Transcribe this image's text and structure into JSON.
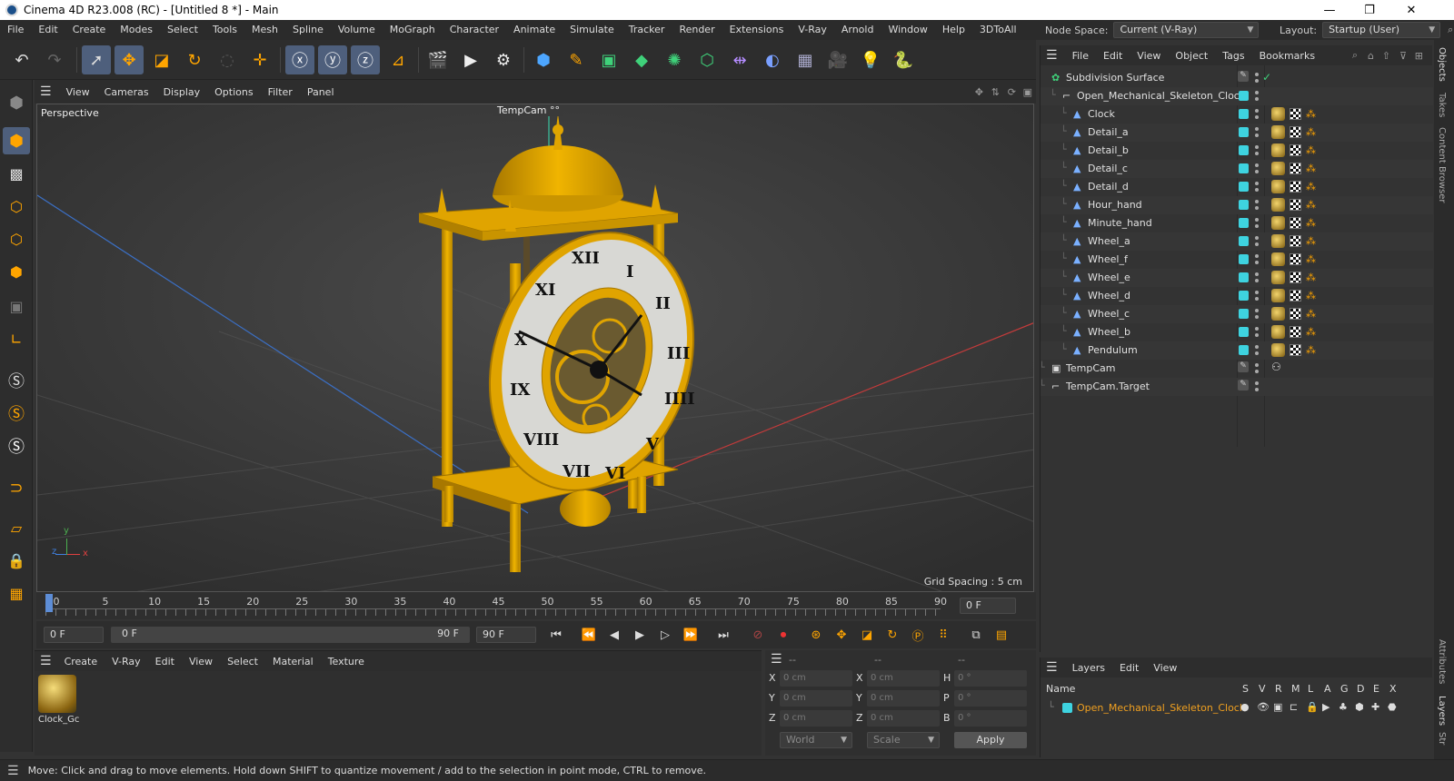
{
  "window": {
    "title": "Cinema 4D R23.008 (RC) - [Untitled 8 *] - Main",
    "minimize": "—",
    "restore": "❐",
    "close": "✕"
  },
  "menu": [
    "File",
    "Edit",
    "Create",
    "Modes",
    "Select",
    "Tools",
    "Mesh",
    "Spline",
    "Volume",
    "MoGraph",
    "Character",
    "Animate",
    "Simulate",
    "Tracker",
    "Render",
    "Extensions",
    "V-Ray",
    "Arnold",
    "Window",
    "Help",
    "3DToAll"
  ],
  "nodespace": {
    "label": "Node Space:",
    "value": "Current (V-Ray)"
  },
  "layout": {
    "label": "Layout:",
    "value": "Startup (User)"
  },
  "viewport": {
    "menu": [
      "View",
      "Cameras",
      "Display",
      "Options",
      "Filter",
      "Panel"
    ],
    "label": "Perspective",
    "camera_label": "TempCam",
    "grid_spacing": "Grid Spacing : 5 cm",
    "axis": {
      "y": "y",
      "z": "z",
      "x": "x"
    }
  },
  "timeline": {
    "ticks": [
      "0",
      "5",
      "10",
      "15",
      "20",
      "25",
      "30",
      "35",
      "40",
      "45",
      "50",
      "55",
      "60",
      "65",
      "70",
      "75",
      "80",
      "85",
      "90"
    ],
    "current_frame": "0 F",
    "start_field": "0 F",
    "range_start": "0 F",
    "range_end": "90 F",
    "end_field": "90 F"
  },
  "material_manager": {
    "menu": [
      "Create",
      "V-Ray",
      "Edit",
      "View",
      "Select",
      "Material",
      "Texture"
    ],
    "materials": [
      {
        "name": "Clock_Gc"
      }
    ]
  },
  "coordinates": {
    "header": [
      "--",
      "--",
      "--"
    ],
    "rows": [
      {
        "a": "X",
        "av": "0 cm",
        "b": "X",
        "bv": "0 cm",
        "c": "H",
        "cv": "0 °"
      },
      {
        "a": "Y",
        "av": "0 cm",
        "b": "Y",
        "bv": "0 cm",
        "c": "P",
        "cv": "0 °"
      },
      {
        "a": "Z",
        "av": "0 cm",
        "b": "Z",
        "bv": "0 cm",
        "c": "B",
        "cv": "0 °"
      }
    ],
    "space": "World",
    "mode": "Scale",
    "apply": "Apply"
  },
  "object_manager": {
    "menu": [
      "File",
      "Edit",
      "View",
      "Object",
      "Tags",
      "Bookmarks"
    ],
    "objects": [
      {
        "name": "Subdivision Surface",
        "level": 0,
        "kind": "subdiv"
      },
      {
        "name": "Open_Mechanical_Skeleton_Clock",
        "level": 1,
        "kind": "null"
      },
      {
        "name": "Clock",
        "level": 2,
        "kind": "poly"
      },
      {
        "name": "Detail_a",
        "level": 2,
        "kind": "poly"
      },
      {
        "name": "Detail_b",
        "level": 2,
        "kind": "poly"
      },
      {
        "name": "Detail_c",
        "level": 2,
        "kind": "poly"
      },
      {
        "name": "Detail_d",
        "level": 2,
        "kind": "poly"
      },
      {
        "name": "Hour_hand",
        "level": 2,
        "kind": "poly"
      },
      {
        "name": "Minute_hand",
        "level": 2,
        "kind": "poly"
      },
      {
        "name": "Wheel_a",
        "level": 2,
        "kind": "poly"
      },
      {
        "name": "Wheel_f",
        "level": 2,
        "kind": "poly"
      },
      {
        "name": "Wheel_e",
        "level": 2,
        "kind": "poly"
      },
      {
        "name": "Wheel_d",
        "level": 2,
        "kind": "poly"
      },
      {
        "name": "Wheel_c",
        "level": 2,
        "kind": "poly"
      },
      {
        "name": "Wheel_b",
        "level": 2,
        "kind": "poly"
      },
      {
        "name": "Pendulum",
        "level": 2,
        "kind": "poly"
      },
      {
        "name": "TempCam",
        "level": 0,
        "kind": "camera"
      },
      {
        "name": "TempCam.Target",
        "level": 0,
        "kind": "target"
      }
    ]
  },
  "layers": {
    "menu": [
      "Layers",
      "Edit",
      "View"
    ],
    "header_name": "Name",
    "columns": [
      "S",
      "V",
      "R",
      "M",
      "L",
      "A",
      "G",
      "D",
      "E",
      "X"
    ],
    "rows": [
      {
        "name": "Open_Mechanical_Skeleton_Clock"
      }
    ]
  },
  "side_tabs": [
    "Objects",
    "Takes",
    "Content Browser",
    "Attributes",
    "Layers",
    "Str"
  ],
  "status": "Move: Click and drag to move elements. Hold down SHIFT to quantize movement / add to the selection in point mode, CTRL to remove.",
  "colors": {
    "accent": "#4e5f7c",
    "layer": "#3ed3e0",
    "gold": "#e0a400",
    "layer_text": "#f0a020"
  }
}
